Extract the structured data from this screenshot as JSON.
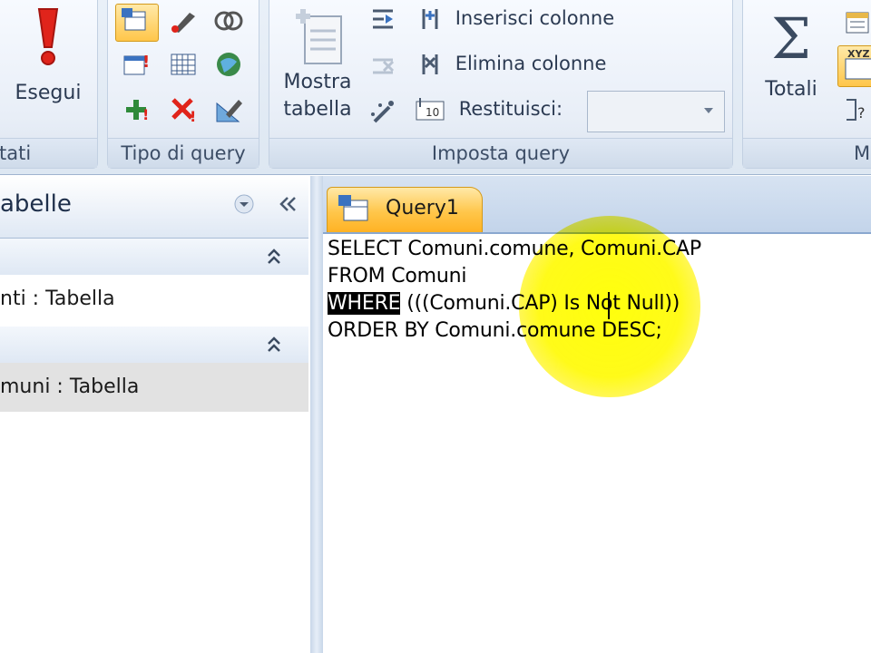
{
  "ribbon": {
    "groups": [
      {
        "label": "tati"
      },
      {
        "label": "Tipo di query"
      },
      {
        "label": "Imposta query"
      },
      {
        "label": "M"
      }
    ],
    "run_button": {
      "label": "Esegui",
      "icon": "exclamation-icon"
    },
    "show_table_button": {
      "label_line1": "Mostra",
      "label_line2": "tabella",
      "icon": "table-add-icon"
    },
    "query_setup": {
      "insert_columns": "Inserisci colonne",
      "delete_columns": "Elimina colonne",
      "return_label": "Restituisci:",
      "return_value": ""
    },
    "totals_button": {
      "label": "Totali",
      "icon": "sigma-icon"
    }
  },
  "nav": {
    "title": "abelle",
    "categories": [
      {
        "item": "nti : Tabella"
      },
      {
        "item": "muni : Tabella"
      }
    ]
  },
  "document": {
    "tab_label": "Query1",
    "sql_lines": [
      "SELECT Comuni.comune, Comuni.CAP",
      "FROM Comuni",
      "(((Comuni.CAP) Is Not Null))",
      "ORDER BY Comuni.comune DESC;"
    ],
    "selected_keyword": "WHERE"
  },
  "colors": {
    "accent_tab": "#ffc64a",
    "ribbon_bg": "#e9f0f8",
    "highlight": "#ffff00"
  }
}
